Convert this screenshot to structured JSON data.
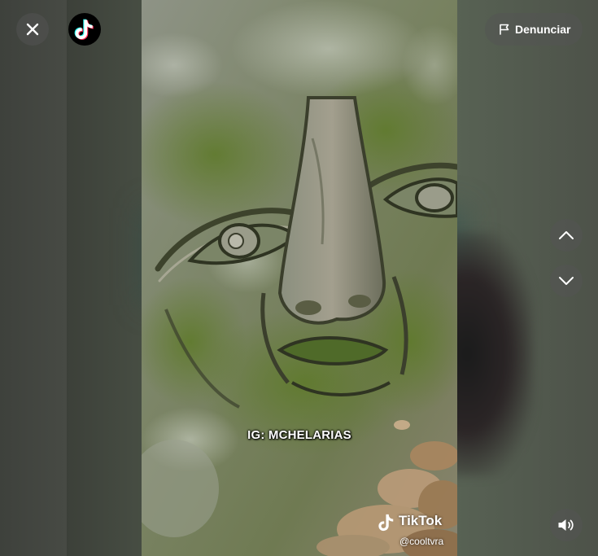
{
  "app": {
    "logo_icon": "tiktok-logo-icon"
  },
  "toolbar": {
    "close_icon": "close-icon",
    "report_label": "Denunciar",
    "report_icon": "flag-icon"
  },
  "navigation": {
    "previous_icon": "chevron-up-icon",
    "next_icon": "chevron-down-icon"
  },
  "player": {
    "caption": "IG: MCHELARIAS",
    "watermark_brand": "TikTok",
    "watermark_handle": "@cooltvra",
    "volume_icon": "speaker-icon"
  },
  "colors": {
    "overlay_button": "#545454",
    "logo_cyan": "#25F4EE",
    "logo_red": "#FE2C55",
    "icon": "#FFFFFF"
  }
}
